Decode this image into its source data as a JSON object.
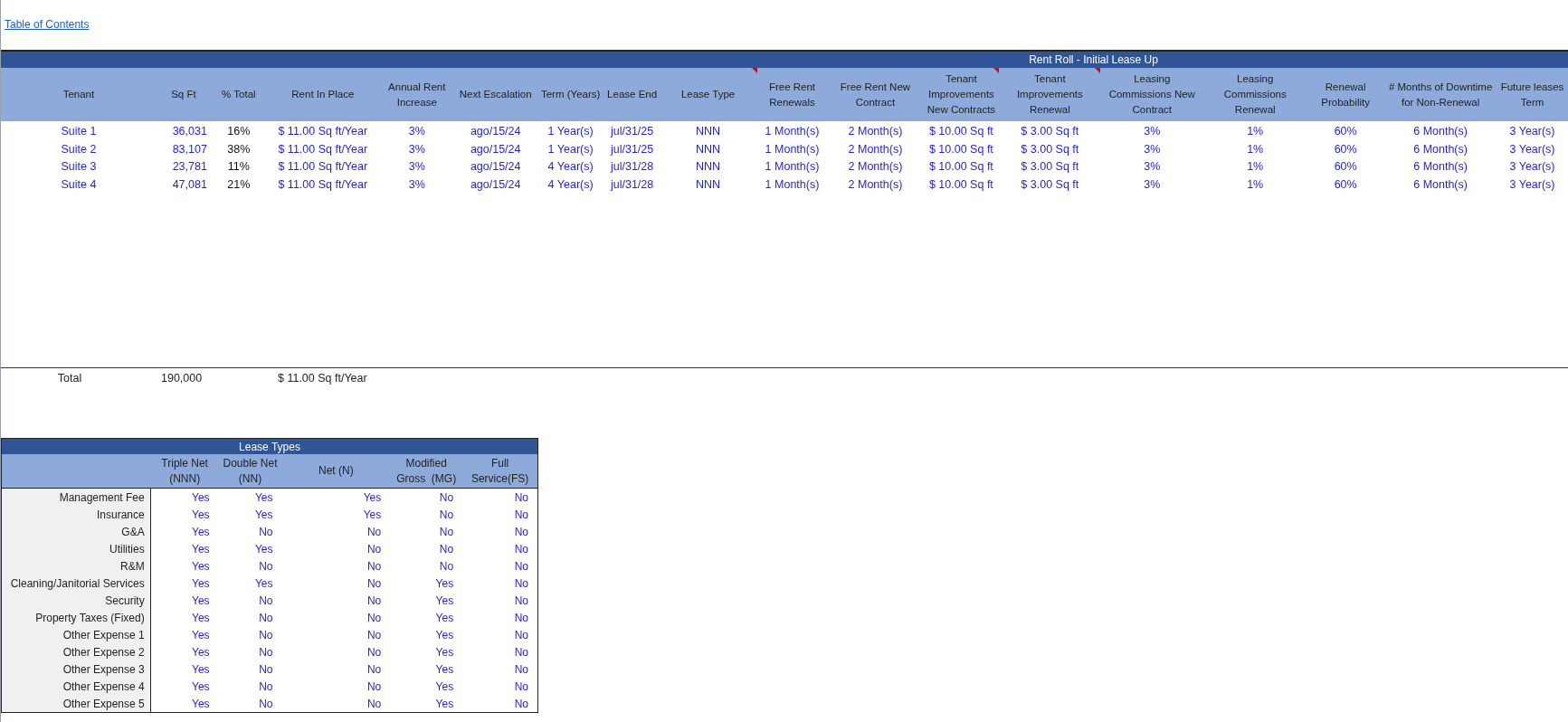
{
  "link": {
    "label": "Table of Contents"
  },
  "rent_roll": {
    "title": "Rent Roll - Initial Lease Up",
    "columns": [
      {
        "label": "Tenant",
        "kind": "input",
        "has_comment": false
      },
      {
        "label": "Sq Ft",
        "kind": "input",
        "has_comment": false
      },
      {
        "label": "% Total",
        "kind": "calc",
        "has_comment": false
      },
      {
        "label": "Rent In Place",
        "kind": "input",
        "has_comment": false
      },
      {
        "label": "Annual Rent Increase",
        "kind": "input",
        "has_comment": false
      },
      {
        "label": "Next Escalation",
        "kind": "input",
        "has_comment": false
      },
      {
        "label": "Term (Years)",
        "kind": "input",
        "has_comment": false
      },
      {
        "label": "Lease End",
        "kind": "input",
        "has_comment": false
      },
      {
        "label": "Lease Type",
        "kind": "input",
        "has_comment": true
      },
      {
        "label": "Free Rent Renewals",
        "kind": "input",
        "has_comment": false
      },
      {
        "label": "Free Rent New Contract",
        "kind": "input",
        "has_comment": false
      },
      {
        "label": "Tenant Improvements New Contracts",
        "kind": "input",
        "has_comment": true
      },
      {
        "label": "Tenant Improvements Renewal",
        "kind": "input",
        "has_comment": true
      },
      {
        "label": "Leasing Commissions New Contract",
        "kind": "input",
        "has_comment": false
      },
      {
        "label": "Leasing Commissions Renewal",
        "kind": "input",
        "has_comment": false
      },
      {
        "label": "Renewal Probability",
        "kind": "input",
        "has_comment": false
      },
      {
        "label": "# Months of Downtime for Non-Renewal",
        "kind": "input",
        "has_comment": false
      },
      {
        "label": "Future leases Term",
        "kind": "input",
        "has_comment": false
      }
    ],
    "rows": [
      [
        "Suite 1",
        "36,031",
        "16%",
        "$ 11.00 Sq ft/Year",
        "3%",
        "ago/15/24",
        "1 Year(s)",
        "jul/31/25",
        "NNN",
        "1 Month(s)",
        "2 Month(s)",
        "$ 10.00 Sq ft",
        "$ 3.00 Sq ft",
        "3%",
        "1%",
        "60%",
        "6 Month(s)",
        "3 Year(s)"
      ],
      [
        "Suite 2",
        "83,107",
        "38%",
        "$ 11.00 Sq ft/Year",
        "3%",
        "ago/15/24",
        "1 Year(s)",
        "jul/31/25",
        "NNN",
        "1 Month(s)",
        "2 Month(s)",
        "$ 10.00 Sq ft",
        "$ 3.00 Sq ft",
        "3%",
        "1%",
        "60%",
        "6 Month(s)",
        "3 Year(s)"
      ],
      [
        "Suite 3",
        "23,781",
        "11%",
        "$ 11.00 Sq ft/Year",
        "3%",
        "ago/15/24",
        "4 Year(s)",
        "jul/31/28",
        "NNN",
        "1 Month(s)",
        "2 Month(s)",
        "$ 10.00 Sq ft",
        "$ 3.00 Sq ft",
        "3%",
        "1%",
        "60%",
        "6 Month(s)",
        "3 Year(s)"
      ],
      [
        "Suite 4",
        "47,081",
        "21%",
        "$ 11.00 Sq ft/Year",
        "3%",
        "ago/15/24",
        "4 Year(s)",
        "jul/31/28",
        "NNN",
        "1 Month(s)",
        "2 Month(s)",
        "$ 10.00 Sq ft",
        "$ 3.00 Sq ft",
        "3%",
        "1%",
        "60%",
        "6 Month(s)",
        "3 Year(s)"
      ]
    ],
    "total": {
      "label": "Total",
      "sq_ft": "190,000",
      "rent": "$ 11.00 Sq ft/Year"
    }
  },
  "lease_types": {
    "title": "Lease Types",
    "columns": [
      "Triple Net (NNN)",
      "Double Net (NN)",
      "Net (N)",
      "Modified Gross  (MG)",
      "Full Service(FS)"
    ],
    "rows": [
      {
        "label": "Management Fee",
        "values": [
          "Yes",
          "Yes",
          "Yes",
          "No",
          "No"
        ]
      },
      {
        "label": "Insurance",
        "values": [
          "Yes",
          "Yes",
          "Yes",
          "No",
          "No"
        ]
      },
      {
        "label": "G&A",
        "values": [
          "Yes",
          "No",
          "No",
          "No",
          "No"
        ]
      },
      {
        "label": "Utilities",
        "values": [
          "Yes",
          "Yes",
          "No",
          "No",
          "No"
        ]
      },
      {
        "label": "R&M",
        "values": [
          "Yes",
          "No",
          "No",
          "No",
          "No"
        ]
      },
      {
        "label": "Cleaning/Janitorial Services",
        "values": [
          "Yes",
          "Yes",
          "No",
          "Yes",
          "No"
        ]
      },
      {
        "label": "Security",
        "values": [
          "Yes",
          "No",
          "No",
          "Yes",
          "No"
        ]
      },
      {
        "label": "Property Taxes (Fixed)",
        "values": [
          "Yes",
          "No",
          "No",
          "Yes",
          "No"
        ]
      },
      {
        "label": "Other Expense 1",
        "values": [
          "Yes",
          "No",
          "No",
          "Yes",
          "No"
        ]
      },
      {
        "label": "Other Expense 2",
        "values": [
          "Yes",
          "No",
          "No",
          "Yes",
          "No"
        ]
      },
      {
        "label": "Other Expense 3",
        "values": [
          "Yes",
          "No",
          "No",
          "Yes",
          "No"
        ]
      },
      {
        "label": "Other Expense 4",
        "values": [
          "Yes",
          "No",
          "No",
          "Yes",
          "No"
        ]
      },
      {
        "label": "Other Expense 5",
        "values": [
          "Yes",
          "No",
          "No",
          "Yes",
          "No"
        ]
      }
    ]
  }
}
